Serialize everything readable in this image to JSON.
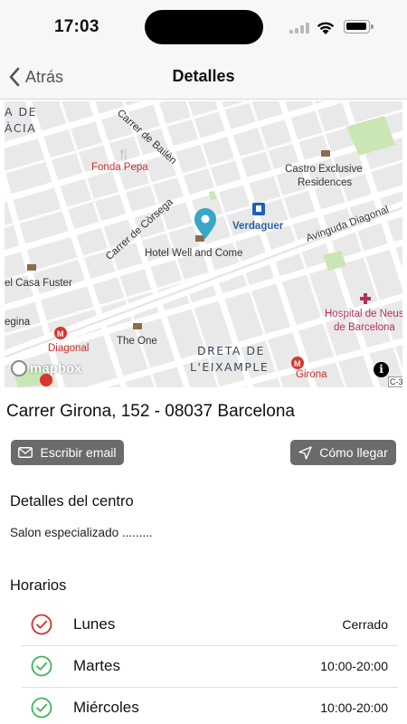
{
  "status_bar": {
    "time": "17:03"
  },
  "nav": {
    "back_label": "Atrás",
    "title": "Detalles"
  },
  "map": {
    "labels": {
      "street_bailen": "Carrer de Bailèn",
      "street_corsega": "Carrer de Còrsega",
      "avinguda_diagonal": "Avinguda Diagonal",
      "fonda_pepa": "Fonda Pepa",
      "castro_line1": "Castro Exclusive",
      "castro_line2": "Residences",
      "verdaguer": "Verdaguer",
      "hotel_well": "Hotel Well and Come",
      "casa_fuster": "el Casa Fuster",
      "gina": "egina",
      "diagonal_station": "Diagonal",
      "the_one": "The One",
      "hospital_line1": "Hospital de Neus",
      "hospital_line2": "de Barcelona",
      "dreta_line1": "DRETA DE",
      "dreta_line2": "L'EIXAMPLE",
      "girona_station": "Girona",
      "gracia_line1": "A DE",
      "gracia_line2": "ÀCIA",
      "c3": "C-3"
    },
    "attribution": "mapbox",
    "info": "i"
  },
  "address": "Carrer Girona, 152 - 08037 Barcelona",
  "actions": {
    "email_label": "Escribir email",
    "route_label": "Cómo llegar"
  },
  "center": {
    "title": "Detalles del centro",
    "description": "Salon especializado ........."
  },
  "schedule": {
    "title": "Horarios",
    "rows": [
      {
        "day": "Lunes",
        "hours": "Cerrado",
        "status": "closed"
      },
      {
        "day": "Martes",
        "hours": "10:00-20:00",
        "status": "open"
      },
      {
        "day": "Miércoles",
        "hours": "10:00-20:00",
        "status": "open"
      }
    ]
  },
  "colors": {
    "accent_button": "#6b6b6b",
    "closed_red": "#d32f2f",
    "open_green": "#3cb55c",
    "map_pin": "#3aa6c6"
  }
}
